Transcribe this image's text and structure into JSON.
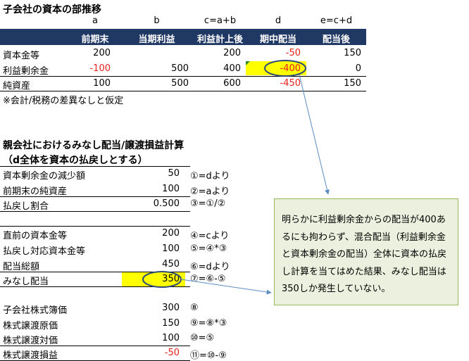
{
  "sub": {
    "title": "子会社の資本の部推移",
    "col_letters": [
      "a",
      "b",
      "c=a+b",
      "d",
      "e=c+d"
    ],
    "col_headers": [
      "前期末",
      "当期利益",
      "利益計上後",
      "期中配当",
      "配当後"
    ],
    "rows": [
      {
        "label": "資本金等",
        "values": [
          "200",
          "",
          "200",
          "-50",
          "150"
        ]
      },
      {
        "label": "利益剰余金",
        "values": [
          "-100",
          "500",
          "400",
          "-400",
          "0"
        ]
      },
      {
        "label": "純資産",
        "values": [
          "100",
          "500",
          "600",
          "-450",
          "150"
        ]
      }
    ],
    "note": "※会計/税務の差異なしと仮定"
  },
  "parent": {
    "title": "親会社におけるみなし配当/譲渡損益計算",
    "subtitle": "（d全体を資本の払戻しとする）",
    "rows": [
      {
        "label": "資本剰余金の減少額",
        "value": "50",
        "formula": "①=dより"
      },
      {
        "label": "前期末の純資産",
        "value": "100",
        "formula": "②=aより"
      },
      {
        "label": "払戻し割合",
        "value": "0.500",
        "formula": "③=①/②"
      },
      {
        "label": "直前の資本金等",
        "value": "200",
        "formula": "④=cより"
      },
      {
        "label": "払戻し対応資本金等",
        "value": "100",
        "formula": "⑤=④*③"
      },
      {
        "label": "配当総額",
        "value": "450",
        "formula": "⑥=dより"
      },
      {
        "label": "みなし配当",
        "value": "350",
        "formula": "⑦=⑥-⑤"
      },
      {
        "label": "子会社株式簿価",
        "value": "300",
        "formula": "⑧"
      },
      {
        "label": "株式譲渡原価",
        "value": "150",
        "formula": "⑨=⑧*③"
      },
      {
        "label": "株式譲渡対価",
        "value": "100",
        "formula": "⑩=⑤"
      },
      {
        "label": "株式譲渡損益",
        "value": "-50",
        "formula": "⑪=⑩-⑨"
      }
    ]
  },
  "callout": {
    "text": "明らかに利益剰余金からの配当が400あるにも拘わらず、混合配当（利益剰余金と資本剰余金の配当）全体に資本の払戻し計算を当てはめた結果、みなし配当は350しか発生していない。"
  },
  "colors": {
    "header_bg": "#1f3864",
    "negative": "#e8231a",
    "highlight": "#ffff00",
    "callout_bg": "#ebf1de",
    "ellipse": "#2e4a7a",
    "arrow": "#5b8bc0"
  }
}
